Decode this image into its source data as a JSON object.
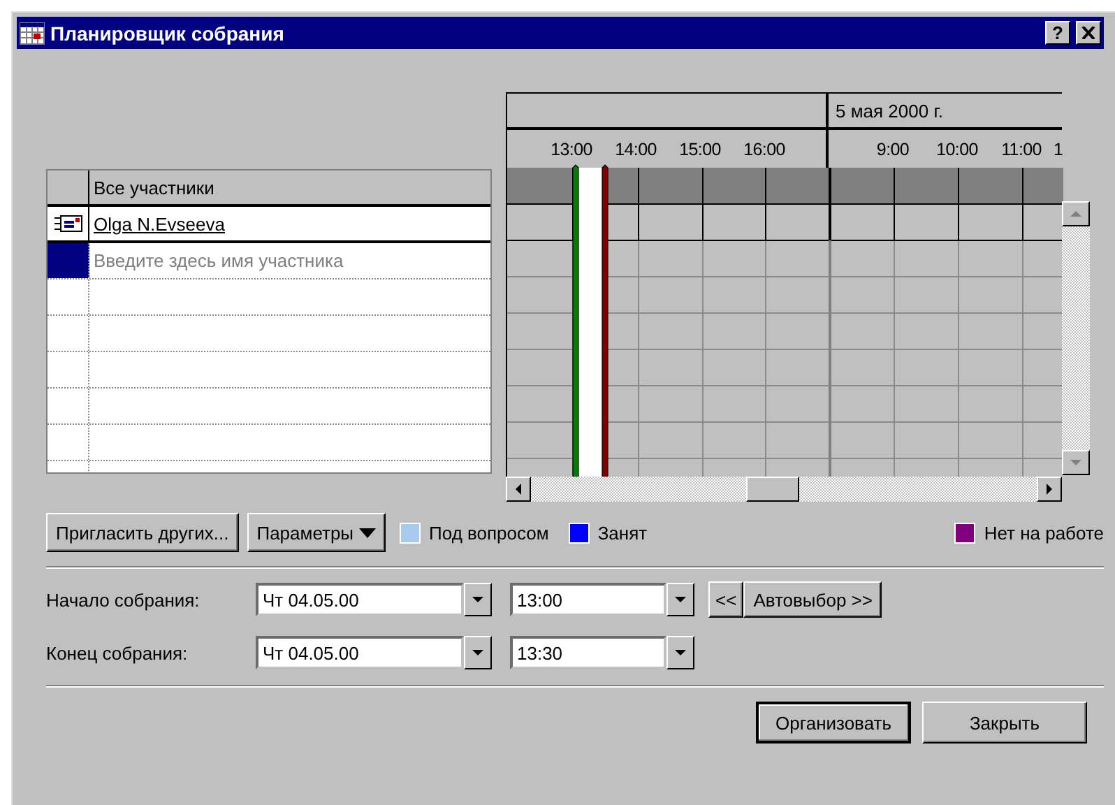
{
  "window": {
    "title": "Планировщик собрания",
    "help_button": "?"
  },
  "attendees": {
    "header": "Все участники",
    "rows": [
      {
        "kind": "attendee",
        "name": "Olga N.Evseeva"
      },
      {
        "kind": "new",
        "placeholder": "Введите здесь имя участника"
      }
    ]
  },
  "schedule": {
    "days": [
      {
        "times": [
          "13:00",
          "14:00",
          "15:00",
          "16:00"
        ]
      },
      {
        "label": "5 мая 2000 г.",
        "times": [
          "9:00",
          "10:00",
          "11:00",
          "1"
        ]
      }
    ]
  },
  "actions": [
    {
      "label": "Пригласить других...",
      "kind": "plain"
    },
    {
      "label": "Параметры",
      "kind": "menu"
    }
  ],
  "legend": [
    {
      "label": "Под вопросом",
      "color": "#a6caf0"
    },
    {
      "label": "Занят",
      "color": "#0000ff"
    },
    {
      "label": "Нет на работе",
      "color": "#800080"
    }
  ],
  "start": {
    "label": "Начало собрания:",
    "date": "Чт 04.05.00",
    "time": "13:00"
  },
  "end": {
    "label": "Конец собрания:",
    "date": "Чт 04.05.00",
    "time": "13:30"
  },
  "autopick": {
    "back": "<<",
    "forward": "Автовыбор >>"
  },
  "footer": [
    {
      "label": "Организовать",
      "default": true
    },
    {
      "label": "Закрыть",
      "default": false
    }
  ]
}
